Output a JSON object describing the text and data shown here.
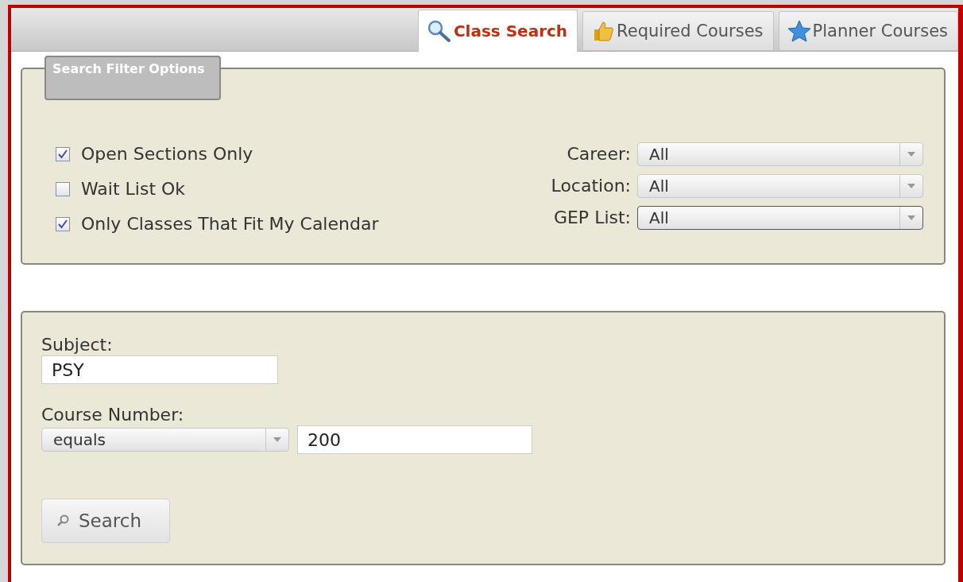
{
  "tabs": [
    {
      "label": "Class Search",
      "selected": true
    },
    {
      "label": "Required Courses",
      "selected": false
    },
    {
      "label": "Planner Courses",
      "selected": false
    }
  ],
  "filter_panel": {
    "legend": "Search Filter Options",
    "checkboxes": [
      {
        "label": "Open Sections Only",
        "checked": true
      },
      {
        "label": "Wait List Ok",
        "checked": false
      },
      {
        "label": "Only Classes That Fit My Calendar",
        "checked": true
      }
    ],
    "dropdowns": [
      {
        "label": "Career:",
        "value": "All",
        "focused": false
      },
      {
        "label": "Location:",
        "value": "All",
        "focused": false
      },
      {
        "label": "GEP List:",
        "value": "All",
        "focused": true
      }
    ]
  },
  "search_panel": {
    "subject": {
      "label": "Subject:",
      "value": "PSY"
    },
    "course_number": {
      "label": "Course Number:",
      "operator": "equals",
      "value": "200"
    },
    "search_button": "Search"
  }
}
